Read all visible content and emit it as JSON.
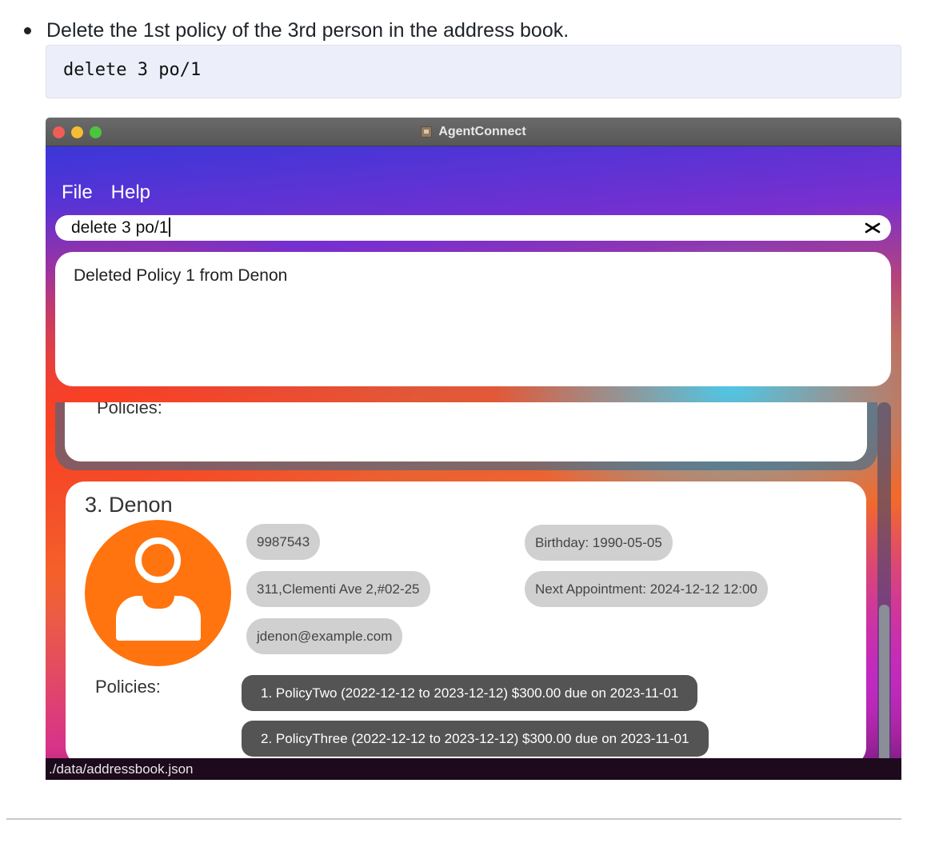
{
  "doc": {
    "instruction": "Delete the 1st policy of the 3rd person in the address book.",
    "code": "delete 3 po/1"
  },
  "window": {
    "title": "AgentConnect",
    "menu": {
      "file": "File",
      "help": "Help"
    },
    "command": {
      "value": "delete 3 po/1"
    },
    "result": "Deleted Policy 1 from Denon",
    "previous_card": {
      "policies_label": "Policies:"
    },
    "person": {
      "name": "3. Denon",
      "phone": "9987543",
      "address": "311,Clementi Ave 2,#02-25",
      "email": "jdenon@example.com",
      "birthday": "Birthday: 1990-05-05",
      "appointment": "Next Appointment: 2024-12-12 12:00",
      "policies_label": "Policies:",
      "policies": [
        "1. PolicyTwo (2022-12-12 to 2023-12-12) $300.00 due on 2023-11-01",
        "2. PolicyThree (2022-12-12 to 2023-12-12) $300.00 due on 2023-11-01"
      ]
    },
    "status": "./data/addressbook.json"
  },
  "colors": {
    "avatar": "#ff740e",
    "chip": "#d0d0d0",
    "policy_chip": "#545454",
    "code_bg": "#eceefa"
  }
}
